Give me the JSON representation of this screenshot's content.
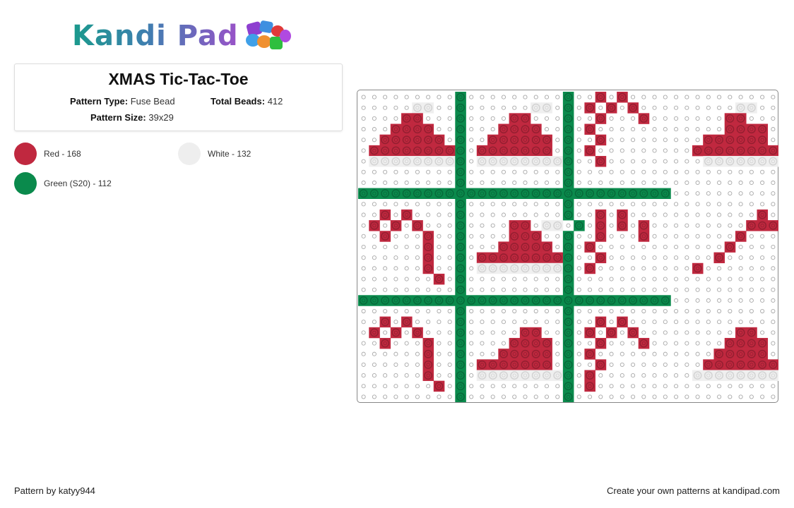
{
  "brand": {
    "name": "Kandi Pad",
    "logo_icon": "beads-pile-icon"
  },
  "pattern": {
    "title": "XMAS Tic-Tac-Toe",
    "type_label": "Pattern Type:",
    "type_value": "Fuse Bead",
    "total_label": "Total Beads:",
    "total_value": "412",
    "size_label": "Pattern Size:",
    "size_value": "39x29"
  },
  "legend": [
    {
      "label": "Red - 168",
      "color": "#c0283f"
    },
    {
      "label": "White - 132",
      "color": "#eeeeee"
    },
    {
      "label": "Green (S20) - 112",
      "color": "#0a8a4c"
    }
  ],
  "grid": {
    "columns": 39,
    "rows": 29,
    "colors": {
      "r": "#c0283f",
      "w": "#efefef",
      "g": "#0a8a4c"
    },
    "cells": [
      ".........g.........g..r.r..............",
      ".....ww..g......ww.g.r.r.r.........ww..",
      "....rr...g....rr...g..r...r.......rr...",
      "...rrrr..g...rrrr..g.r............rrrr.",
      "..rrrrrr.g..rrrrrr.g..r.........rrrrrr.",
      ".rrrrrrrrg.rrrrrrr.g.r.........rrrrrrrr",
      ".wwwwwwwwg.wwwwwwwwg..r.........wwwwwww",
      ".........g.........g...................",
      ".........g.........g...................",
      "ggggggggggggggggggggggggggggg..........",
      ".........g.........g...................",
      "..r.r....g.........g..r.r............r.",
      ".r.r.r...g....rr.ww.g.r.r.r.........rrr",
      "..r...r..g....rrr..g..r...r........r...",
      "......r..g...rrrrr.g.r............r....",
      "......r..g.rrrrrrrrg..r..........r.....",
      "......r..g.wwwwwwwwg.r.........r.......",
      ".......r.g.........g...................",
      ".........g.........g...................",
      "ggggggggggggggggggggggggggggg..........",
      ".........g.........g...................",
      "..r.r....g.........g..r.r..............",
      ".r.r.r...g.....rr..g.r.r.r.........rr..",
      "..r...r..g....rrrr.g..r...r.......rrrr.",
      "......r..g...rrrrr.g.r...........rrrrr.",
      "......r..g.rrrrrrr.g..r.........rrrrrrr",
      "......r..g.wwwwwwwwg.r.........wwwwwwww",
      ".......r.g.........g.r.................",
      ".........g.........g..................."
    ]
  },
  "footer": {
    "credit": "Pattern by katyy944",
    "cta": "Create your own patterns at kandipad.com"
  }
}
